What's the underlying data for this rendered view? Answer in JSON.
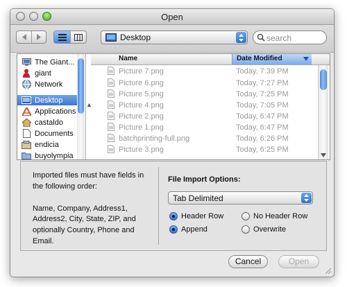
{
  "window": {
    "title": "Open"
  },
  "toolbar": {
    "location": "Desktop",
    "search_placeholder": "search"
  },
  "sidebar": {
    "items": [
      {
        "label": "The Giant...",
        "icon": "computer-icon"
      },
      {
        "label": "giant",
        "icon": "user-home-icon"
      },
      {
        "label": "Network",
        "icon": "network-globe-icon"
      },
      {
        "label": "Desktop",
        "icon": "desktop-icon",
        "selected": true
      },
      {
        "label": "Applications",
        "icon": "applications-icon"
      },
      {
        "label": "castaldo",
        "icon": "user-home-icon"
      },
      {
        "label": "Documents",
        "icon": "documents-icon"
      },
      {
        "label": "endicia",
        "icon": "endicia-icon"
      },
      {
        "label": "buyolympia",
        "icon": "folder-icon"
      }
    ]
  },
  "files": {
    "col_name": "Name",
    "col_date": "Date Modified",
    "rows": [
      {
        "name": "Picture 7.png",
        "date": "Today, 7:39 PM"
      },
      {
        "name": "Picture 6.png",
        "date": "Today, 7:27 PM"
      },
      {
        "name": "Picture 5.png",
        "date": "Today, 7:25 PM"
      },
      {
        "name": "Picture 4.png",
        "date": "Today, 7:05 PM"
      },
      {
        "name": "Picture 2.png",
        "date": "Today, 6:47 PM"
      },
      {
        "name": "Picture 1.png",
        "date": "Today, 6:47 PM"
      },
      {
        "name": "batchprinting-full.png",
        "date": "Today, 6:26 PM"
      },
      {
        "name": "Picture 3.png",
        "date": "Today, 6:25 PM"
      }
    ]
  },
  "import": {
    "note_line1": "Imported files must have fields in the following order:",
    "note_line2": "Name, Company, Address1, Address2, City, State, ZIP, and optionally Country, Phone and Email.",
    "options_title": "File Import Options:",
    "format": "Tab Delimited",
    "radio_header_row": "Header Row",
    "radio_no_header_row": "No Header Row",
    "radio_append": "Append",
    "radio_overwrite": "Overwrite"
  },
  "buttons": {
    "cancel": "Cancel",
    "open": "Open"
  }
}
